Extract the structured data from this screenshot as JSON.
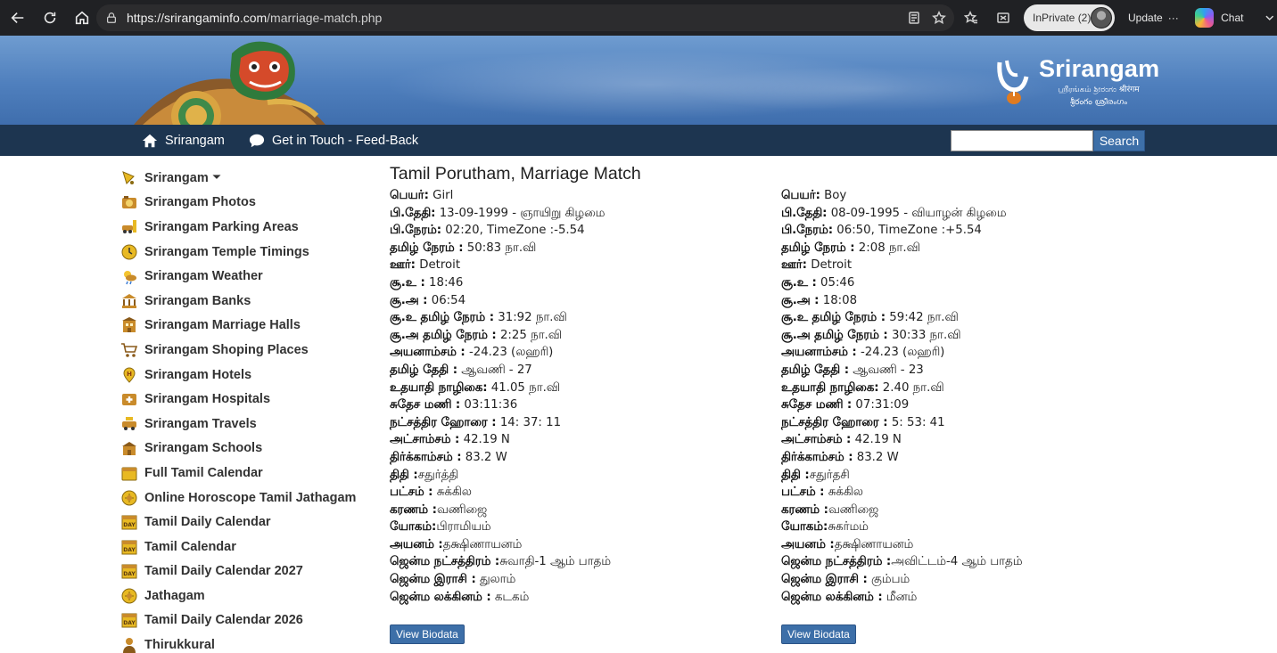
{
  "browser": {
    "url_host": "https://srirangaminfo.com",
    "url_path": "/marriage-match.php",
    "inprivate_label": "InPrivate (2)",
    "update_label": "Update",
    "update_more": "···",
    "chat_label": "Chat"
  },
  "banner": {
    "logo_title": "Srirangam",
    "logo_sub_1": "ஶ்ரீரங்கம்  ಶ್ರೀರಂಗಂ  श्रीरंगम",
    "logo_sub_2": "శ్రీరంగం  ശ്രീരംഗം"
  },
  "topnav": {
    "home_label": "Srirangam",
    "contact_label": "Get in Touch - Feed-Back",
    "search_placeholder": "",
    "search_button": "Search"
  },
  "sidebar": {
    "items": [
      {
        "label": "Srirangam",
        "icon": "bell-icon",
        "caret": "⏷"
      },
      {
        "label": "Srirangam Photos",
        "icon": "photos-icon"
      },
      {
        "label": "Srirangam Parking Areas",
        "icon": "parking-icon"
      },
      {
        "label": "Srirangam Temple Timings",
        "icon": "clock-icon"
      },
      {
        "label": "Srirangam Weather",
        "icon": "weather-icon"
      },
      {
        "label": "Srirangam Banks",
        "icon": "bank-icon"
      },
      {
        "label": "Srirangam Marriage Halls",
        "icon": "hall-icon"
      },
      {
        "label": "Srirangam Shoping Places",
        "icon": "cart-icon"
      },
      {
        "label": "Srirangam Hotels",
        "icon": "hotel-icon"
      },
      {
        "label": "Srirangam Hospitals",
        "icon": "hospital-icon"
      },
      {
        "label": "Srirangam Travels",
        "icon": "taxi-icon"
      },
      {
        "label": "Srirangam Schools",
        "icon": "school-icon"
      },
      {
        "label": "Full Tamil Calendar",
        "icon": "calendar-icon"
      },
      {
        "label": "Online Horoscope Tamil Jathagam",
        "icon": "horoscope-icon"
      },
      {
        "label": "Tamil Daily Calendar",
        "icon": "day-calendar-icon"
      },
      {
        "label": "Tamil Calendar",
        "icon": "day-calendar-icon"
      },
      {
        "label": "Tamil Daily Calendar 2027",
        "icon": "day-calendar-icon"
      },
      {
        "label": "Jathagam",
        "icon": "horoscope-icon"
      },
      {
        "label": "Tamil Daily Calendar 2026",
        "icon": "day-calendar-icon"
      },
      {
        "label": "Thirukkural",
        "icon": "poet-icon"
      }
    ]
  },
  "main": {
    "title": "Tamil Porutham, Marriage Match",
    "biodata_button": "View Biodata",
    "girl": [
      {
        "k": "பெயர்:",
        "v": " Girl"
      },
      {
        "k": "பி.தேதி:",
        "v": " 13-09-1999 - ஞாயிறு கிழமை"
      },
      {
        "k": "பி.நேரம்:",
        "v": " 02:20, TimeZone :-5.54"
      },
      {
        "k": "தமிழ் நேரம் :",
        "v": " 50:83 நா.வி"
      },
      {
        "k": "ஊர்:",
        "v": " Detroit"
      },
      {
        "k": "சூ.உ :",
        "v": " 18:46"
      },
      {
        "k": "சூ.அ :",
        "v": " 06:54"
      },
      {
        "k": "சூ.உ தமிழ் நேரம் :",
        "v": " 31:92 நா.வி"
      },
      {
        "k": "சூ.அ தமிழ் நேரம் :",
        "v": " 2:25 நா.வி"
      },
      {
        "k": "அயனாம்சம் :",
        "v": " -24.23 (லஹரி)"
      },
      {
        "k": "தமிழ் தேதி :",
        "v": " ஆவணி - 27"
      },
      {
        "k": "உதயாதி நாழிகை:",
        "v": " 41.05 நா.வி"
      },
      {
        "k": "சுதேச மணி :",
        "v": " 03:11:36"
      },
      {
        "k": "நட்சத்திர ஹோரை :",
        "v": " 14: 37: 11"
      },
      {
        "k": "அட்சாம்சம் :",
        "v": " 42.19 N"
      },
      {
        "k": "திர்க்காம்சம் :",
        "v": " 83.2 W"
      },
      {
        "k": "திதி :",
        "v": "சதுர்த்தி"
      },
      {
        "k": "பட்சம் :",
        "v": " சுக்கில"
      },
      {
        "k": "கரணம் :",
        "v": "வணிஜை"
      },
      {
        "k": "யோகம்:",
        "v": "பிராமியம்"
      },
      {
        "k": "அயனம் :",
        "v": "தக்ஷிணாயனம்"
      },
      {
        "k": "ஜென்ம நட்சத்திரம் :",
        "v": "சுவாதி-1 ஆம் பாதம்"
      },
      {
        "k": "ஜென்ம இராசி :",
        "v": " துலாம்"
      },
      {
        "k": "ஜென்ம லக்கினம் :",
        "v": " கடகம்"
      }
    ],
    "boy": [
      {
        "k": "பெயர்:",
        "v": " Boy"
      },
      {
        "k": "பி.தேதி:",
        "v": " 08-09-1995 - வியாழன் கிழமை"
      },
      {
        "k": "பி.நேரம்:",
        "v": " 06:50, TimeZone :+5.54"
      },
      {
        "k": "தமிழ் நேரம் :",
        "v": " 2:08 நா.வி"
      },
      {
        "k": "ஊர்:",
        "v": " Detroit"
      },
      {
        "k": "சூ.உ :",
        "v": " 05:46"
      },
      {
        "k": "சூ.அ :",
        "v": " 18:08"
      },
      {
        "k": "சூ.உ தமிழ் நேரம் :",
        "v": " 59:42 நா.வி"
      },
      {
        "k": "சூ.அ தமிழ் நேரம் :",
        "v": " 30:33 நா.வி"
      },
      {
        "k": "அயனாம்சம் :",
        "v": " -24.23 (லஹரி)"
      },
      {
        "k": "தமிழ் தேதி :",
        "v": " ஆவணி - 23"
      },
      {
        "k": "உதயாதி நாழிகை:",
        "v": " 2.40 நா.வி"
      },
      {
        "k": "சுதேச மணி :",
        "v": " 07:31:09"
      },
      {
        "k": "நட்சத்திர ஹோரை :",
        "v": " 5: 53: 41"
      },
      {
        "k": "அட்சாம்சம் :",
        "v": " 42.19 N"
      },
      {
        "k": "திர்க்காம்சம் :",
        "v": " 83.2 W"
      },
      {
        "k": "திதி :",
        "v": "சதுர்தசி"
      },
      {
        "k": "பட்சம் :",
        "v": " சுக்கில"
      },
      {
        "k": "கரணம் :",
        "v": "வணிஜை"
      },
      {
        "k": "யோகம்:",
        "v": "சுகர்மம்"
      },
      {
        "k": "அயனம் :",
        "v": "தக்ஷிணாயனம்"
      },
      {
        "k": "ஜென்ம நட்சத்திரம் :",
        "v": "அவிட்டம்-4 ஆம் பாதம்"
      },
      {
        "k": "ஜென்ம இராசி :",
        "v": " கும்பம்"
      },
      {
        "k": "ஜென்ம லக்கினம் :",
        "v": " மீனம்"
      }
    ]
  },
  "colors": {
    "chrome_bg": "#202124",
    "banner_blue": "#4f7fbd",
    "nav_bg": "#1d3550",
    "button_blue": "#3d6fa8"
  }
}
